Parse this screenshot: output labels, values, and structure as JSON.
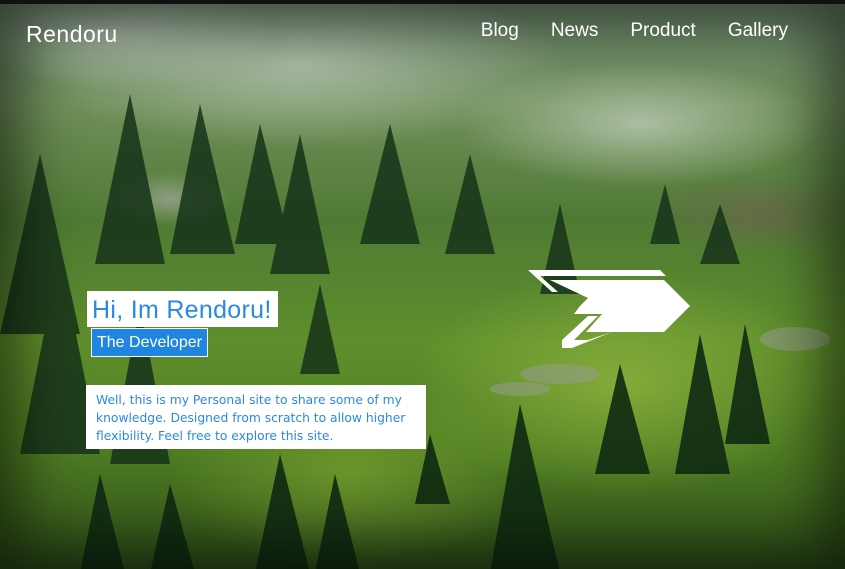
{
  "header": {
    "brand": "Rendoru",
    "nav": [
      {
        "label": "Blog"
      },
      {
        "label": "News"
      },
      {
        "label": "Product"
      },
      {
        "label": "Gallery"
      }
    ]
  },
  "hero": {
    "title": "Hi, Im Rendoru!",
    "subtitle": "The Developer",
    "description": "Well, this is my Personal site to share some of my knowledge. Designed from scratch to allow higher flexibility. Feel free to explore this site."
  },
  "colors": {
    "accent": "#2b8ae0",
    "subtitle_bg": "#1f86e0",
    "text_light": "#ffffff"
  },
  "icons": {
    "logo": "chevron-arrow-logo-icon"
  }
}
